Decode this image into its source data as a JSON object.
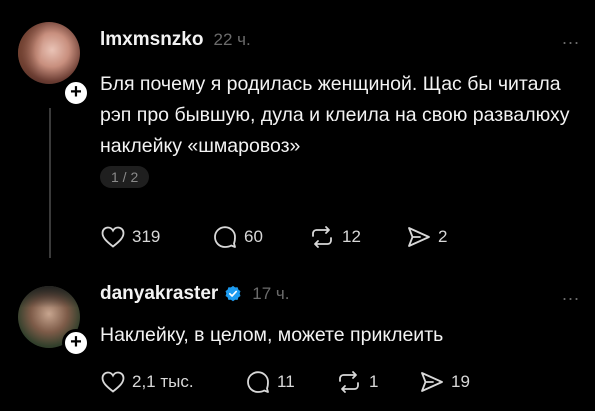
{
  "posts": [
    {
      "username": "lmxmsnzko",
      "time": "22 ч.",
      "text": "Бля почему я родилась женщиной. Щас бы читала рэп про бывшую, дула и клеила на свою развалюху наклейку «шмаровоз»",
      "pager": "1 / 2",
      "more": "...",
      "likes": "319",
      "replies": "60",
      "reposts": "12",
      "shares": "2"
    },
    {
      "username": "danyakraster",
      "time": "17 ч.",
      "text": "Наклейку, в целом, можете приклеить",
      "more": "...",
      "likes": "2,1 тыс.",
      "replies": "11",
      "reposts": "1",
      "shares": "19"
    }
  ],
  "icons": [
    "heart-icon",
    "comment-icon",
    "repost-icon",
    "share-icon",
    "follow-plus-icon",
    "verified-badge-icon",
    "more-options-icon"
  ],
  "colors": {
    "background": "#000000",
    "text": "#f3f3f3",
    "muted": "#6b6b6b",
    "verified": "#1d9bf0"
  }
}
